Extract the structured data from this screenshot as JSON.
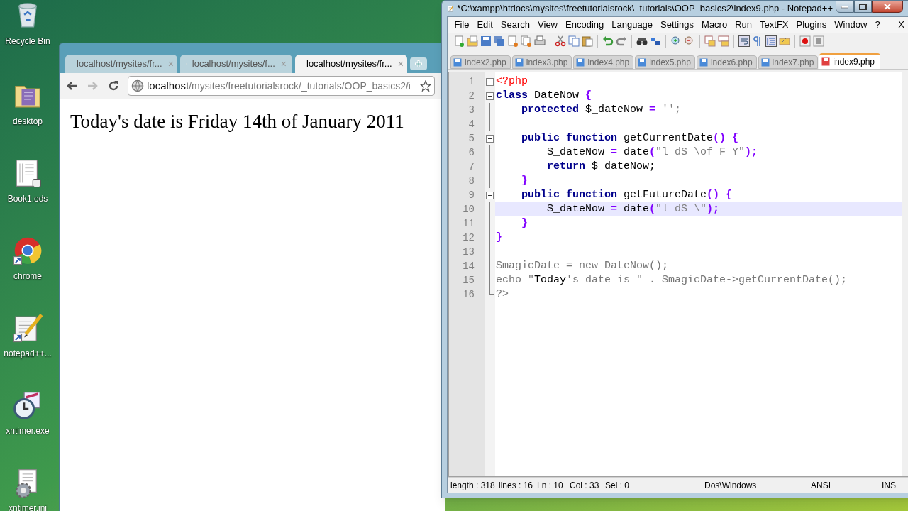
{
  "desktop": {
    "icons": [
      {
        "label": "Recycle Bin",
        "kind": "bin"
      },
      {
        "label": "desktop",
        "kind": "folder"
      },
      {
        "label": "Book1.ods",
        "kind": "sheet"
      },
      {
        "label": "chrome",
        "kind": "chrome"
      },
      {
        "label": "notepad++...",
        "kind": "notepad"
      },
      {
        "label": "xntimer.exe",
        "kind": "timer"
      },
      {
        "label": "xntimer.ini",
        "kind": "ini"
      }
    ]
  },
  "browser": {
    "tabs": [
      {
        "title": "localhost/mysites/fr...",
        "close": "×",
        "selected": false
      },
      {
        "title": "localhost/mysites/f...",
        "close": "×",
        "selected": false
      },
      {
        "title": "localhost/mysites/fr...",
        "close": "×",
        "selected": true
      }
    ],
    "address": {
      "host": "localhost",
      "path": "/mysites/freetutorialsrock/_tutorials/OOP_basics2/i"
    },
    "content": "Today's date is Friday 14th of January 2011"
  },
  "editor": {
    "title": "*C:\\xampp\\htdocs\\mysites\\freetutorialsrock\\_tutorials\\OOP_basics2\\index9.php - Notepad++",
    "menu": [
      "File",
      "Edit",
      "Search",
      "View",
      "Encoding",
      "Language",
      "Settings",
      "Macro",
      "Run",
      "TextFX",
      "Plugins",
      "Window",
      "?"
    ],
    "menu_close": "X",
    "tabs": [
      {
        "label": "index2.php",
        "selected": false
      },
      {
        "label": "index3.php",
        "selected": false
      },
      {
        "label": "index4.php",
        "selected": false
      },
      {
        "label": "index5.php",
        "selected": false
      },
      {
        "label": "index6.php",
        "selected": false
      },
      {
        "label": "index7.php",
        "selected": false
      },
      {
        "label": "index9.php",
        "selected": true
      }
    ],
    "lines": [
      {
        "number": "1",
        "fold": true,
        "current": false,
        "tokens": [
          {
            "kind": "tag",
            "text": "<?php"
          }
        ]
      },
      {
        "number": "2",
        "fold": true,
        "current": false,
        "tokens": [
          {
            "kind": "kw",
            "text": "class"
          },
          {
            "kind": "plain",
            "text": " DateNow "
          },
          {
            "kind": "op",
            "text": "{"
          }
        ]
      },
      {
        "number": "3",
        "fold": false,
        "current": false,
        "tokens": [
          {
            "kind": "kw",
            "text": "    protected"
          },
          {
            "kind": "plain",
            "text": " $_dateNow "
          },
          {
            "kind": "op",
            "text": "="
          },
          {
            "kind": "str",
            "text": " '';"
          }
        ]
      },
      {
        "number": "4",
        "fold": false,
        "current": false
      },
      {
        "number": "5",
        "fold": true,
        "current": false,
        "tokens": [
          {
            "kind": "kw",
            "text": "    public function"
          },
          {
            "kind": "plain",
            "text": " getCurrentDate"
          },
          {
            "kind": "op",
            "text": "() {"
          }
        ]
      },
      {
        "number": "6",
        "fold": false,
        "current": false,
        "tokens": [
          {
            "kind": "plain",
            "text": "        $_dateNow "
          },
          {
            "kind": "op",
            "text": "="
          },
          {
            "kind": "plain",
            "text": " date"
          },
          {
            "kind": "op",
            "text": "("
          },
          {
            "kind": "str",
            "text": "\"l dS \\of F Y\""
          },
          {
            "kind": "op",
            "text": ");"
          }
        ]
      },
      {
        "number": "7",
        "fold": false,
        "current": false,
        "tokens": [
          {
            "kind": "kw",
            "text": "        return"
          },
          {
            "kind": "plain",
            "text": " $_dateNow;"
          }
        ]
      },
      {
        "number": "8",
        "fold": false,
        "current": false,
        "tokens": [
          {
            "kind": "op",
            "text": "    }"
          }
        ]
      },
      {
        "number": "9",
        "fold": true,
        "current": false,
        "tokens": [
          {
            "kind": "kw",
            "text": "    public function"
          },
          {
            "kind": "plain",
            "text": " getFutureDate"
          },
          {
            "kind": "op",
            "text": "() {"
          }
        ]
      },
      {
        "number": "10",
        "fold": false,
        "current": true,
        "tokens": [
          {
            "kind": "plain",
            "text": "        $_dateNow "
          },
          {
            "kind": "op",
            "text": "="
          },
          {
            "kind": "plain",
            "text": " date"
          },
          {
            "kind": "op",
            "text": "("
          },
          {
            "kind": "str",
            "text": "\"l dS \\\""
          },
          {
            "kind": "op",
            "text": ");"
          }
        ]
      },
      {
        "number": "11",
        "fold": false,
        "current": false,
        "tokens": [
          {
            "kind": "op",
            "text": "    }"
          }
        ]
      },
      {
        "number": "12",
        "fold": false,
        "current": false,
        "tokens": [
          {
            "kind": "op",
            "text": "}"
          }
        ]
      },
      {
        "number": "13",
        "fold": false,
        "current": false
      },
      {
        "number": "14",
        "fold": false,
        "current": false,
        "tokens": [
          {
            "kind": "dim",
            "text": "$magicDate = new DateNow();"
          }
        ]
      },
      {
        "number": "15",
        "fold": false,
        "current": false,
        "tokens": [
          {
            "kind": "dim",
            "text": "echo \""
          },
          {
            "kind": "plain",
            "text": "Today"
          },
          {
            "kind": "dim",
            "text": "'s date is \" . $magicDate->getCurrentDate();"
          }
        ]
      },
      {
        "number": "16",
        "fold": false,
        "current": false,
        "tokens": [
          {
            "kind": "dim",
            "text": "?>"
          }
        ]
      }
    ],
    "status": [
      "length : 318",
      "lines : 16",
      "Ln : 10",
      "Col : 33",
      "Sel : 0",
      "Dos\\Windows",
      "ANSI",
      "INS"
    ]
  }
}
